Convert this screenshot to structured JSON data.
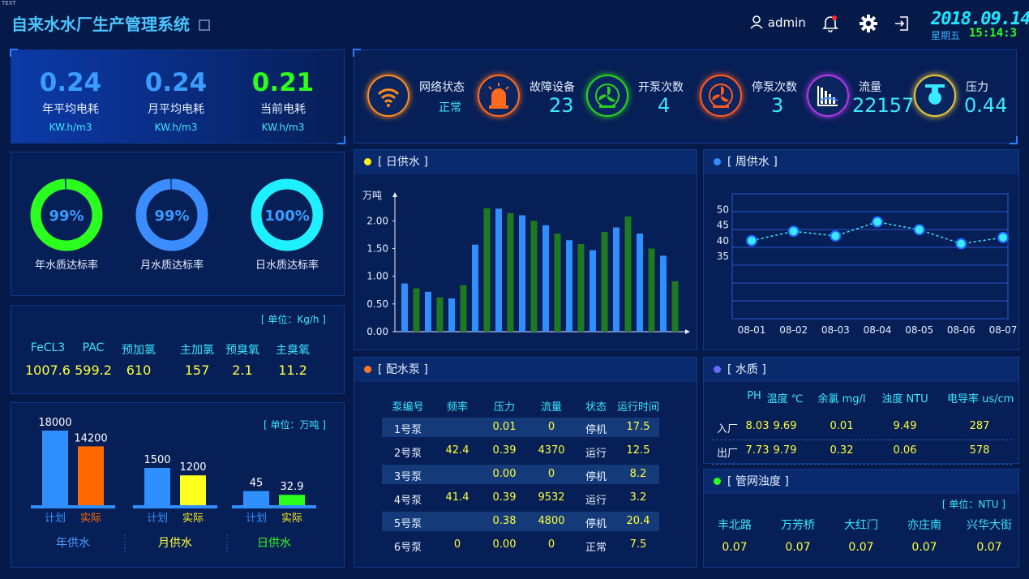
{
  "corner_text": "TEXT",
  "header": {
    "title": "自来水水厂生产管理系统",
    "user": "admin",
    "date": "2018.09.14",
    "weekday": "星期五",
    "time": "15:14:3"
  },
  "energy": {
    "items": [
      {
        "value": "0.24",
        "label": "年平均电耗",
        "unit": "KW.h/m3"
      },
      {
        "value": "0.24",
        "label": "月平均电耗",
        "unit": "KW.h/m3"
      },
      {
        "value": "0.21",
        "label": "当前电耗",
        "unit": "KW.h/m3"
      }
    ]
  },
  "status": {
    "items": [
      {
        "label": "网络状态",
        "value": "正常",
        "icon": "wifi-icon",
        "color": "#ff8a1e"
      },
      {
        "label": "故障设备",
        "value": "23",
        "icon": "alarm-light-icon",
        "color": "#ff6a1e"
      },
      {
        "label": "开泵次数",
        "value": "4",
        "icon": "fan-on-icon",
        "color": "#2bd11e"
      },
      {
        "label": "停泵次数",
        "value": "3",
        "icon": "fan-off-icon",
        "color": "#ff5a1e"
      },
      {
        "label": "流量",
        "value": "22157",
        "icon": "flow-icon",
        "color": "#b03ae8"
      },
      {
        "label": "压力",
        "value": "0.44",
        "icon": "pressure-icon",
        "color": "#e8c43a"
      }
    ]
  },
  "quality_rate": {
    "items": [
      {
        "value": 99,
        "text": "99%",
        "label": "年水质达标率",
        "color": "#2bff1e"
      },
      {
        "value": 99,
        "text": "99%",
        "label": "月水质达标率",
        "color": "#3a8cff"
      },
      {
        "value": 100,
        "text": "100%",
        "label": "日水质达标率",
        "color": "#1ef0ff"
      }
    ]
  },
  "chemicals": {
    "unit": "[ 单位：Kg/h ]",
    "names": [
      "FeCL3",
      "PAC",
      "预加氯",
      "主加氯",
      "预臭氧",
      "主臭氧"
    ],
    "values": [
      "1007.6",
      "599.2",
      "610",
      "157",
      "2.1",
      "11.2"
    ]
  },
  "supply": {
    "unit": "[ 单位：万吨 ]",
    "groups": [
      {
        "name": "年供水",
        "plan": 18000,
        "actual": 14200,
        "plan_label": "18000",
        "actual_label": "14200",
        "name_color": "#4b9cff",
        "actual_color": "#ff6a00"
      },
      {
        "name": "月供水",
        "plan": 1500,
        "actual": 1200,
        "plan_label": "1500",
        "actual_label": "1200",
        "name_color": "#ffff3a",
        "actual_color": "#ffff1e"
      },
      {
        "name": "日供水",
        "plan": 45,
        "actual": 32.9,
        "plan_label": "45",
        "actual_label": "32.9",
        "name_color": "#2bff1e",
        "actual_color": "#2bff1e"
      }
    ],
    "plan_text": "计划",
    "actual_text": "实际"
  },
  "daily_supply": {
    "title": "[ 日供水 ]",
    "dot_color": "#ffee1e",
    "chart_data": {
      "type": "bar",
      "ylabel": "万吨",
      "ylim": [
        0,
        2.4
      ],
      "yticks": [
        "0.00",
        "0.50",
        "1.00",
        "1.50",
        "2.00"
      ],
      "values": [
        0.87,
        0.78,
        0.72,
        0.62,
        0.6,
        0.84,
        1.57,
        2.23,
        2.22,
        2.14,
        2.1,
        2.0,
        1.92,
        1.77,
        1.65,
        1.58,
        1.47,
        1.8,
        1.88,
        2.08,
        1.77,
        1.5,
        1.37,
        0.91
      ],
      "colors": [
        "#2f8fff",
        "#1f7a1f"
      ]
    }
  },
  "weekly_supply": {
    "title": "[ 周供水 ]",
    "dot_color": "#2f8fff",
    "chart_data": {
      "type": "line",
      "x": [
        "08-01",
        "08-02",
        "08-03",
        "08-04",
        "08-05",
        "08-06",
        "08-07"
      ],
      "values": [
        40,
        43,
        41.5,
        46,
        43.5,
        39,
        41
      ],
      "yticks": [
        35,
        40,
        45,
        50
      ],
      "ylim": [
        15,
        55
      ]
    }
  },
  "pumps": {
    "title": "[ 配水泵 ]",
    "dot_color": "#ff7a1e",
    "headers": [
      "泵编号",
      "频率",
      "压力",
      "流量",
      "状态",
      "运行时间"
    ],
    "rows": [
      [
        "1号泵",
        "",
        "0.01",
        "0",
        "停机",
        "17.5"
      ],
      [
        "2号泵",
        "42.4",
        "0.39",
        "4370",
        "运行",
        "12.5"
      ],
      [
        "3号泵",
        "",
        "0.00",
        "0",
        "停机",
        "8.2"
      ],
      [
        "4号泵",
        "41.4",
        "0.39",
        "9532",
        "运行",
        "3.2"
      ],
      [
        "5号泵",
        "",
        "0.38",
        "4800",
        "停机",
        "20.4"
      ],
      [
        "6号泵",
        "0",
        "0.00",
        "0",
        "正常",
        "7.5"
      ]
    ]
  },
  "water_quality": {
    "title": "[ 水质 ]",
    "dot_color": "#6a6aff",
    "headers": [
      "PH",
      "温度 ℃",
      "余氯 mg/l",
      "浊度 NTU",
      "电导率 us/cm"
    ],
    "rows": [
      {
        "label": "入厂",
        "values": [
          "8.03",
          "9.69",
          "0.01",
          "9.49",
          "287"
        ]
      },
      {
        "label": "出厂",
        "values": [
          "7.73",
          "9.79",
          "0.32",
          "0.06",
          "578"
        ]
      }
    ]
  },
  "turbidity": {
    "title": "[ 管网浊度 ]",
    "dot_color": "#2bff1e",
    "unit": "[ 单位：NTU ]",
    "names": [
      "丰北路",
      "万芳桥",
      "大红门",
      "亦庄南",
      "兴华大街"
    ],
    "values": [
      "0.07",
      "0.07",
      "0.07",
      "0.07",
      "0.07"
    ]
  }
}
